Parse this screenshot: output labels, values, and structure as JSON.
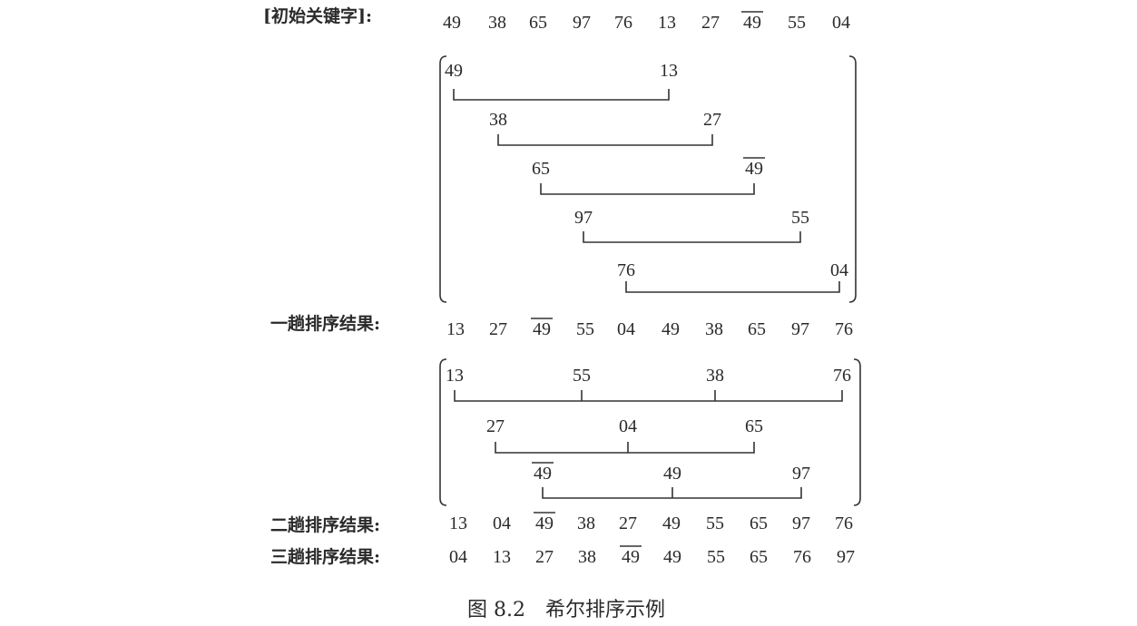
{
  "labels": {
    "initial": "[初始关键字]:",
    "pass1": "一趟排序结果:",
    "pass2": "二趟排序结果:",
    "pass3": "三趟排序结果:"
  },
  "caption": "图 8.2　希尔排序示例",
  "sequences": {
    "initial": [
      {
        "v": "49"
      },
      {
        "v": "38"
      },
      {
        "v": "65"
      },
      {
        "v": "97"
      },
      {
        "v": "76"
      },
      {
        "v": "13"
      },
      {
        "v": "27"
      },
      {
        "v": "49",
        "bar": true
      },
      {
        "v": "55"
      },
      {
        "v": "04"
      }
    ],
    "pass1": [
      {
        "v": "13"
      },
      {
        "v": "27"
      },
      {
        "v": "49",
        "bar": true
      },
      {
        "v": "55"
      },
      {
        "v": "04"
      },
      {
        "v": "49"
      },
      {
        "v": "38"
      },
      {
        "v": "65"
      },
      {
        "v": "97"
      },
      {
        "v": "76"
      }
    ],
    "pass2": [
      {
        "v": "13"
      },
      {
        "v": "04"
      },
      {
        "v": "49",
        "bar": true
      },
      {
        "v": "38"
      },
      {
        "v": "27"
      },
      {
        "v": "49"
      },
      {
        "v": "55"
      },
      {
        "v": "65"
      },
      {
        "v": "97"
      },
      {
        "v": "76"
      }
    ],
    "pass3": [
      {
        "v": "04"
      },
      {
        "v": "13"
      },
      {
        "v": "27"
      },
      {
        "v": "38"
      },
      {
        "v": "49",
        "bar": true
      },
      {
        "v": "49"
      },
      {
        "v": "55"
      },
      {
        "v": "65"
      },
      {
        "v": "76"
      },
      {
        "v": "97"
      }
    ]
  },
  "groups_pass1": [
    [
      {
        "v": "49"
      },
      {
        "v": "13"
      }
    ],
    [
      {
        "v": "38"
      },
      {
        "v": "27"
      }
    ],
    [
      {
        "v": "65"
      },
      {
        "v": "49",
        "bar": true
      }
    ],
    [
      {
        "v": "97"
      },
      {
        "v": "55"
      }
    ],
    [
      {
        "v": "76"
      },
      {
        "v": "04"
      }
    ]
  ],
  "groups_pass2": [
    [
      {
        "v": "13"
      },
      {
        "v": "55"
      },
      {
        "v": "38"
      },
      {
        "v": "76"
      }
    ],
    [
      {
        "v": "27"
      },
      {
        "v": "04"
      },
      {
        "v": "65"
      }
    ],
    [
      {
        "v": "49",
        "bar": true
      },
      {
        "v": "49"
      },
      {
        "v": "97"
      }
    ]
  ]
}
